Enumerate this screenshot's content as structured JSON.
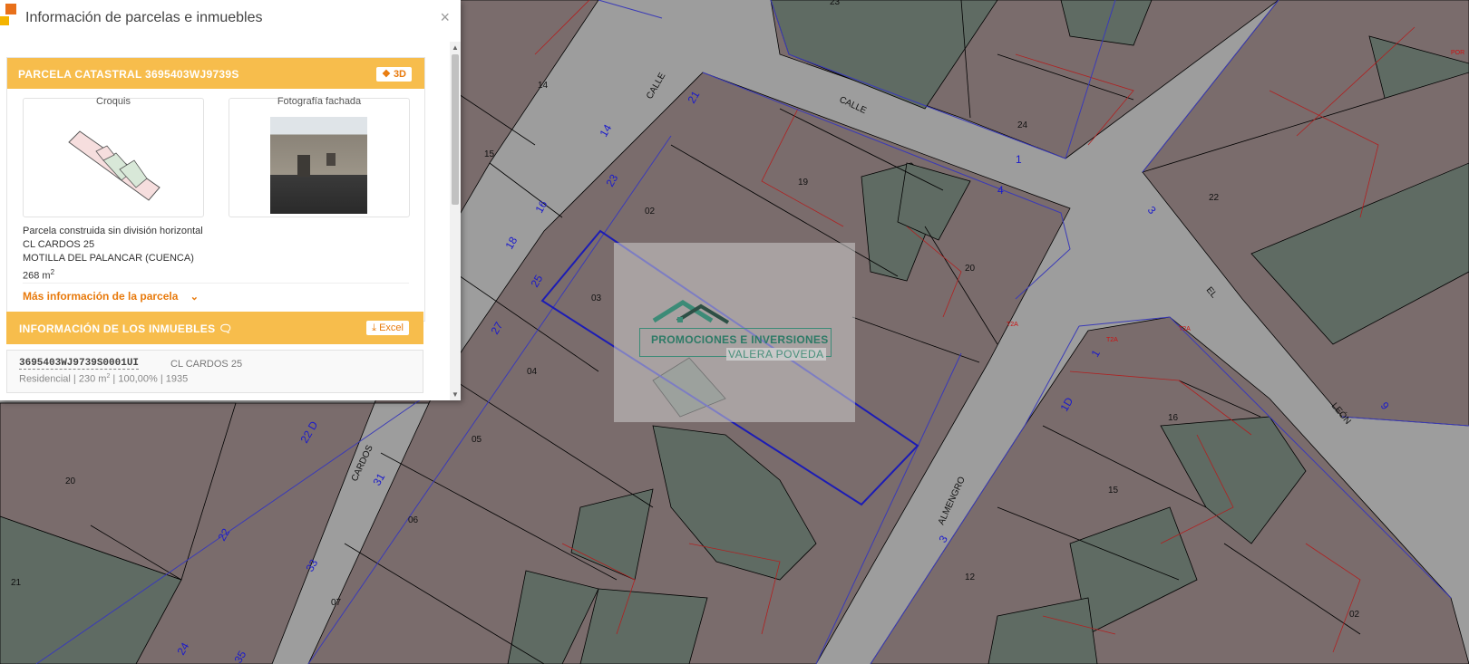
{
  "panel": {
    "title": "Información de parcelas e inmuebles",
    "close": "×",
    "parcel_header": "PARCELA CATASTRAL 3695403WJ9739S",
    "btn_3d": "3D",
    "croquis_label": "Croquis",
    "fachada_label": "Fotografía fachada",
    "info_line1": "Parcela construida sin división horizontal",
    "info_line2": "CL CARDOS 25",
    "info_line3": "MOTILLA DEL PALANCAR (CUENCA)",
    "area_value": "268 m",
    "area_sup": "2",
    "more_info": "Más información de la parcela",
    "inmuebles_header": "INFORMACIÓN DE LOS INMUEBLES",
    "btn_excel": "Excel",
    "inmueble": {
      "ref": "3695403WJ9739S0001UI",
      "address": "CL CARDOS 25",
      "use": "Residencial",
      "area": "230 m",
      "area_sup": "2",
      "share": "100,00%",
      "year": "1935"
    }
  },
  "watermark": {
    "line1": "PROMOCIONES E INVERSIONES",
    "line2": "VALERA POVEDA"
  },
  "map": {
    "colors": {
      "road": "#9d9d9d",
      "parcel": "#7a6c6c",
      "patio": "#5f6b63",
      "selected": "#1c1cb5"
    },
    "street_names": {
      "calle1": "CALLE",
      "calle2": "CALLE",
      "cardos": "CARDOS",
      "almengro": "ALMENGRO",
      "el": "EL",
      "leon": "LEÓN"
    },
    "parcel_labels": {
      "p14": "14",
      "p15": "15",
      "p02a": "02",
      "p19": "19",
      "p24": "24",
      "p22": "22",
      "p03": "03",
      "p04": "04",
      "p05": "05",
      "p06": "06",
      "p07": "07",
      "p20a": "20",
      "p20b": "20",
      "p21": "21",
      "p16": "16",
      "p15b": "15",
      "p12": "12",
      "p02b": "02",
      "p23top": "23"
    },
    "numbers": {
      "n21": "21",
      "n14": "14",
      "n23": "23",
      "n16": "16",
      "n18": "18",
      "n25": "25",
      "n27": "27",
      "n22D": "22 D",
      "n31": "31",
      "n22": "22",
      "n33": "33",
      "n24": "24",
      "n35": "35",
      "n1": "1",
      "n4": "4",
      "n3a": "3",
      "n1D": "1D",
      "n3b": "3",
      "n9": "9",
      "n1b": "1"
    },
    "tags": {
      "t1": "T2A",
      "t2": "T2A",
      "t3": "T2A",
      "t4": "POR"
    }
  }
}
